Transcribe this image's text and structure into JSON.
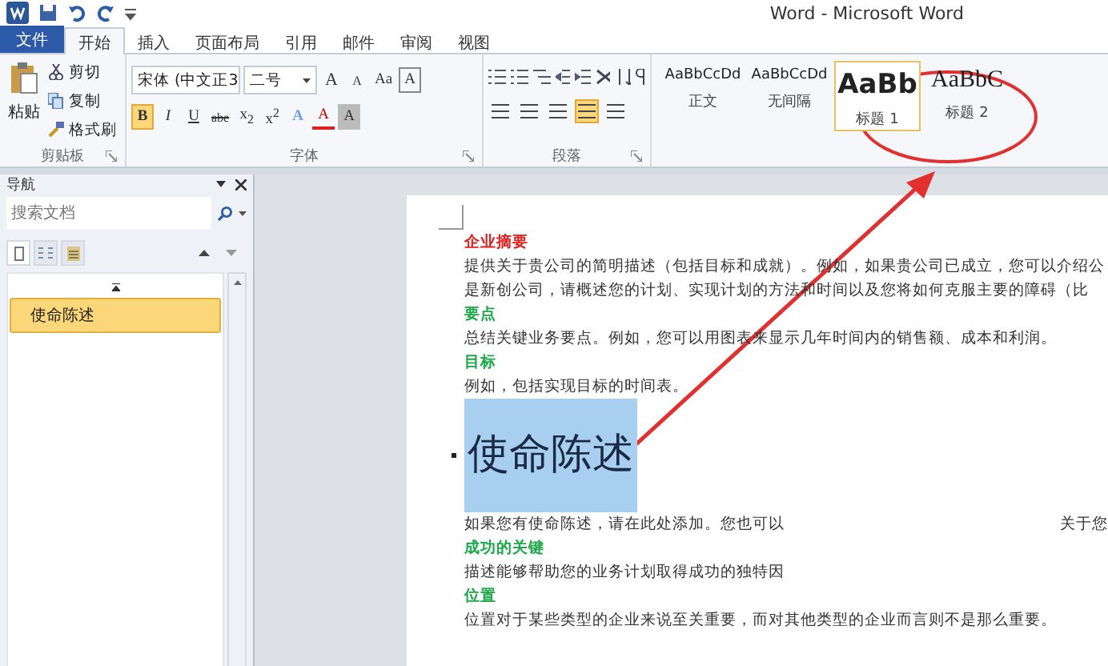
{
  "window": {
    "title": "Word - Microsoft Word"
  },
  "ribbon_tabs": [
    {
      "label": "文件",
      "kind": "file",
      "selected": false
    },
    {
      "label": "开始",
      "kind": "tab",
      "selected": true
    },
    {
      "label": "插入",
      "kind": "tab",
      "selected": false
    },
    {
      "label": "页面布局",
      "kind": "tab",
      "selected": false
    },
    {
      "label": "引用",
      "kind": "tab",
      "selected": false
    },
    {
      "label": "邮件",
      "kind": "tab",
      "selected": false
    },
    {
      "label": "审阅",
      "kind": "tab",
      "selected": false
    },
    {
      "label": "视图",
      "kind": "tab",
      "selected": false
    }
  ],
  "clipboard": {
    "paste": "粘贴",
    "cut": "剪切",
    "copy": "复制",
    "format_painter": "格式刷",
    "group_label": "剪贴板"
  },
  "font": {
    "name": "宋体 (中文正3",
    "size": "二号",
    "group_label": "字体",
    "row_1": [
      {
        "label": "A",
        "kind": "grow",
        "selected": false
      },
      {
        "label": "A",
        "kind": "shrink",
        "selected": false
      },
      {
        "label": "Aa",
        "kind": "plain",
        "selected": false
      },
      {
        "label": "A",
        "kind": "boxed",
        "selected": false
      }
    ],
    "row_2": [
      {
        "label": "B",
        "kind": "bold",
        "selected": true
      },
      {
        "label": "I",
        "kind": "italic",
        "selected": false
      },
      {
        "label": "U",
        "kind": "underline",
        "selected": false
      },
      {
        "label": "abe",
        "kind": "strike",
        "selected": false
      },
      {
        "label": "x$_{2}$",
        "kind": "plain",
        "selected": false
      },
      {
        "label": "x$^{2}$",
        "kind": "plain",
        "selected": false
      },
      {
        "label": "A",
        "kind": "effect",
        "selected": false
      },
      {
        "label": "A",
        "kind": "font_color",
        "selected": false
      },
      {
        "label": "A",
        "kind": "shaded",
        "selected": false
      }
    ]
  },
  "paragraph": {
    "group_label": "段落",
    "align_buttons": [
      {
        "selected": false
      },
      {
        "selected": false
      },
      {
        "selected": false
      },
      {
        "selected": true
      },
      {
        "selected": false
      }
    ]
  },
  "styles": [
    {
      "sample": "AaBbCcDd",
      "label": "正文",
      "kind": "normal",
      "selected": false
    },
    {
      "sample": "AaBbCcDd",
      "label": "无间隔",
      "kind": "normal",
      "selected": false
    },
    {
      "sample": "AaBb",
      "label": "标题 1",
      "kind": "heading1",
      "selected": true
    },
    {
      "sample": "AaBbC",
      "label": "标题 2",
      "kind": "heading2",
      "selected": false
    }
  ],
  "navigation": {
    "title": "导航",
    "search": {
      "placeholder": "搜索文档"
    },
    "items": [
      {
        "label": "使命陈述",
        "selected": true
      }
    ]
  },
  "document": [
    {
      "kind": "red_heading",
      "parts": [
        "企业摘要"
      ]
    },
    {
      "kind": "body",
      "parts": [
        "提供关于贵公司的简明描述（包括目标和成就）。例如，如果贵公司已成立，您可以介绍公"
      ]
    },
    {
      "kind": "body",
      "parts": [
        "是新创公司，请概述您的计划、实现计划的方法和时间以及您将如何克服主要的障碍（比"
      ]
    },
    {
      "kind": "green_heading",
      "parts": [
        "要点"
      ]
    },
    {
      "kind": "body",
      "parts": [
        "总结关键业务要点。例如，您可以用图表来显示几年时间内的销售额、成本和利润。"
      ]
    },
    {
      "kind": "green_heading",
      "parts": [
        "目标"
      ]
    },
    {
      "kind": "body",
      "parts": [
        "例如，包括实现目标的时间表。"
      ]
    },
    {
      "kind": "heading1",
      "selected": true,
      "parts": [
        "使命陈述"
      ]
    },
    {
      "kind": "body",
      "parts": [
        "如果您有使命陈述，请在此处添加。您也可以",
        "关于您"
      ]
    },
    {
      "kind": "green_heading",
      "parts": [
        "成功的关键"
      ]
    },
    {
      "kind": "body",
      "parts": [
        "描述能够帮助您的业务计划取得成功的独特因"
      ]
    },
    {
      "kind": "green_heading",
      "parts": [
        "位置"
      ]
    },
    {
      "kind": "body",
      "parts": [
        "位置对于某些类型的企业来说至关重要，而对其他类型的企业而言则不是那么重要。"
      ]
    }
  ],
  "annotation": {
    "kind": "ellipse_with_arrow"
  }
}
